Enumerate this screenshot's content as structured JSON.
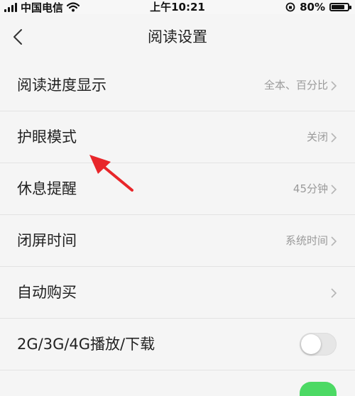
{
  "status_bar": {
    "carrier": "中国电信",
    "time": "上午10:21",
    "battery_percent": "80%",
    "battery_level": 0.8
  },
  "nav": {
    "title": "阅读设置",
    "back_icon": "chevron-left-icon"
  },
  "settings": [
    {
      "label": "阅读进度显示",
      "value": "全本、百分比",
      "control": "chevron"
    },
    {
      "label": "护眼模式",
      "value": "关闭",
      "control": "chevron"
    },
    {
      "label": "休息提醒",
      "value": "45分钟",
      "control": "chevron"
    },
    {
      "label": "闭屏时间",
      "value": "系统时间",
      "control": "chevron"
    },
    {
      "label": "自动购买",
      "value": "",
      "control": "chevron"
    },
    {
      "label": "2G/3G/4G播放/下载",
      "value": "",
      "control": "toggle",
      "toggle_on": false
    }
  ],
  "annotation": {
    "arrow_color": "#e8262a"
  },
  "colors": {
    "toggle_on": "#4cd964",
    "background": "#f5f5f5",
    "value_text": "#9a9a9a"
  }
}
